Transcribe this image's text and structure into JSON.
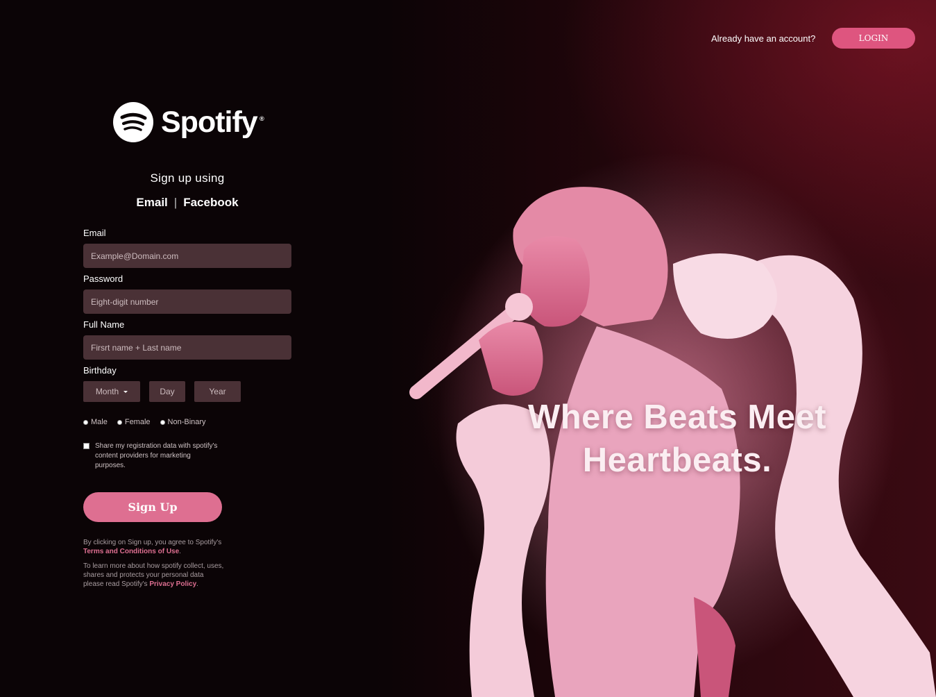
{
  "brand": {
    "name": "Spotify",
    "registered_mark": "®",
    "logo_icon": "spotify-logo-icon"
  },
  "signup": {
    "heading": "Sign up using",
    "methods": [
      "Email",
      "Facebook"
    ],
    "separator": "|"
  },
  "form": {
    "email": {
      "label": "Email",
      "placeholder": "Example@Domain.com"
    },
    "password": {
      "label": "Password",
      "placeholder": "Eight-digit number"
    },
    "full_name": {
      "label": "Full Name",
      "placeholder": "Firsrt name + Last name"
    },
    "birthday": {
      "label": "Birthday",
      "month": "Month",
      "day": "Day",
      "year": "Year"
    },
    "gender_options": [
      "Male",
      "Female",
      "Non-Binary"
    ],
    "share_text": "Share my registration data with spotify's content providers for marketing purposes.",
    "submit_label": "Sign Up"
  },
  "legal": {
    "terms_prefix": "By clicking on Sign up, you agree to Spotify's ",
    "terms_link": "Terms and Conditions of Use",
    "terms_suffix": ".",
    "privacy_prefix": "To learn more about how spotify collect, uses, shares and protects your personal data please read Spotify's ",
    "privacy_link": "Privacy Policy",
    "privacy_suffix": "."
  },
  "header": {
    "already_text": "Already have an account?",
    "login_label": "LOGIN"
  },
  "hero": {
    "headline_line1": "Where Beats Meet",
    "headline_line2": "Heartbeats."
  },
  "colors": {
    "accent": "#de6f91",
    "login": "#de557f",
    "input_bg": "#4a3136",
    "background": "#0b0406"
  }
}
